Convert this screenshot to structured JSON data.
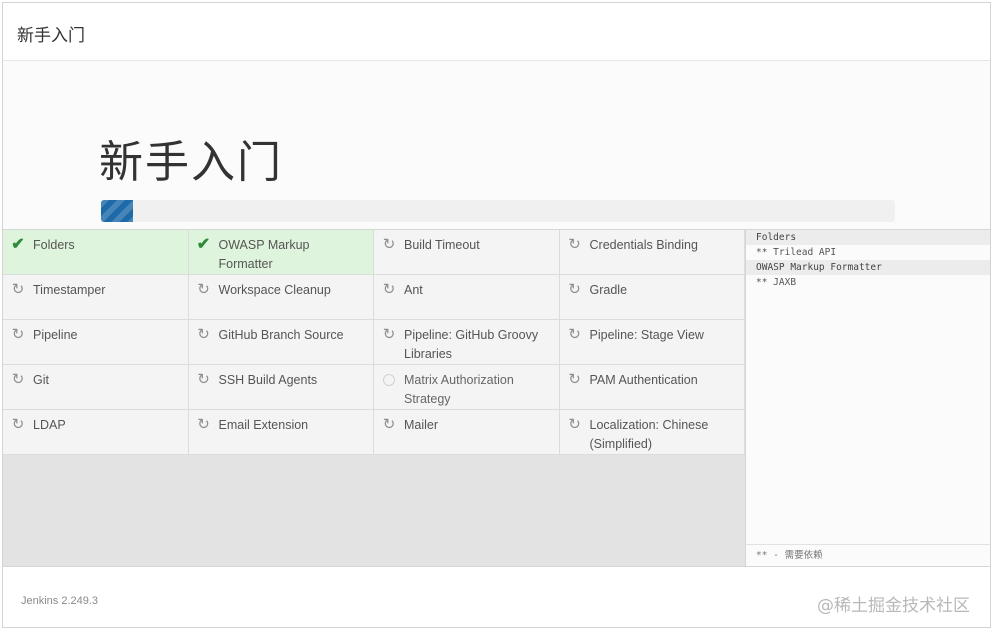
{
  "header": {
    "title": "新手入门"
  },
  "hero": {
    "title": "新手入门",
    "progress": 0.04
  },
  "plugins": [
    {
      "name": "Folders",
      "status": "done",
      "icon": "check-icon"
    },
    {
      "name": "OWASP Markup Formatter",
      "status": "done",
      "icon": "check-icon"
    },
    {
      "name": "Build Timeout",
      "status": "installing",
      "icon": "refresh-icon"
    },
    {
      "name": "Credentials Binding",
      "status": "installing",
      "icon": "refresh-icon"
    },
    {
      "name": "Timestamper",
      "status": "installing",
      "icon": "refresh-icon"
    },
    {
      "name": "Workspace Cleanup",
      "status": "installing",
      "icon": "refresh-icon"
    },
    {
      "name": "Ant",
      "status": "installing",
      "icon": "refresh-icon"
    },
    {
      "name": "Gradle",
      "status": "installing",
      "icon": "refresh-icon"
    },
    {
      "name": "Pipeline",
      "status": "installing",
      "icon": "refresh-icon"
    },
    {
      "name": "GitHub Branch Source",
      "status": "installing",
      "icon": "refresh-icon"
    },
    {
      "name": "Pipeline: GitHub Groovy Libraries",
      "status": "installing",
      "icon": "refresh-icon"
    },
    {
      "name": "Pipeline: Stage View",
      "status": "installing",
      "icon": "refresh-icon"
    },
    {
      "name": "Git",
      "status": "installing",
      "icon": "refresh-icon"
    },
    {
      "name": "SSH Build Agents",
      "status": "installing",
      "icon": "refresh-icon"
    },
    {
      "name": "Matrix Authorization Strategy",
      "status": "pending",
      "icon": "pending-circle-icon"
    },
    {
      "name": "PAM Authentication",
      "status": "installing",
      "icon": "refresh-icon"
    },
    {
      "name": "LDAP",
      "status": "installing",
      "icon": "refresh-icon"
    },
    {
      "name": "Email Extension",
      "status": "installing",
      "icon": "refresh-icon"
    },
    {
      "name": "Mailer",
      "status": "installing",
      "icon": "refresh-icon"
    },
    {
      "name": "Localization: Chinese (Simplified)",
      "status": "installing",
      "icon": "refresh-icon"
    }
  ],
  "log": {
    "lines": [
      {
        "text": "Folders",
        "type": "head"
      },
      {
        "text": "** Trilead API",
        "type": "dep"
      },
      {
        "text": "OWASP Markup Formatter",
        "type": "head"
      },
      {
        "text": "** JAXB",
        "type": "dep"
      }
    ],
    "legend": "** - 需要依赖"
  },
  "footer": {
    "version": "Jenkins 2.249.3"
  },
  "watermark": "@稀土掘金技术社区"
}
